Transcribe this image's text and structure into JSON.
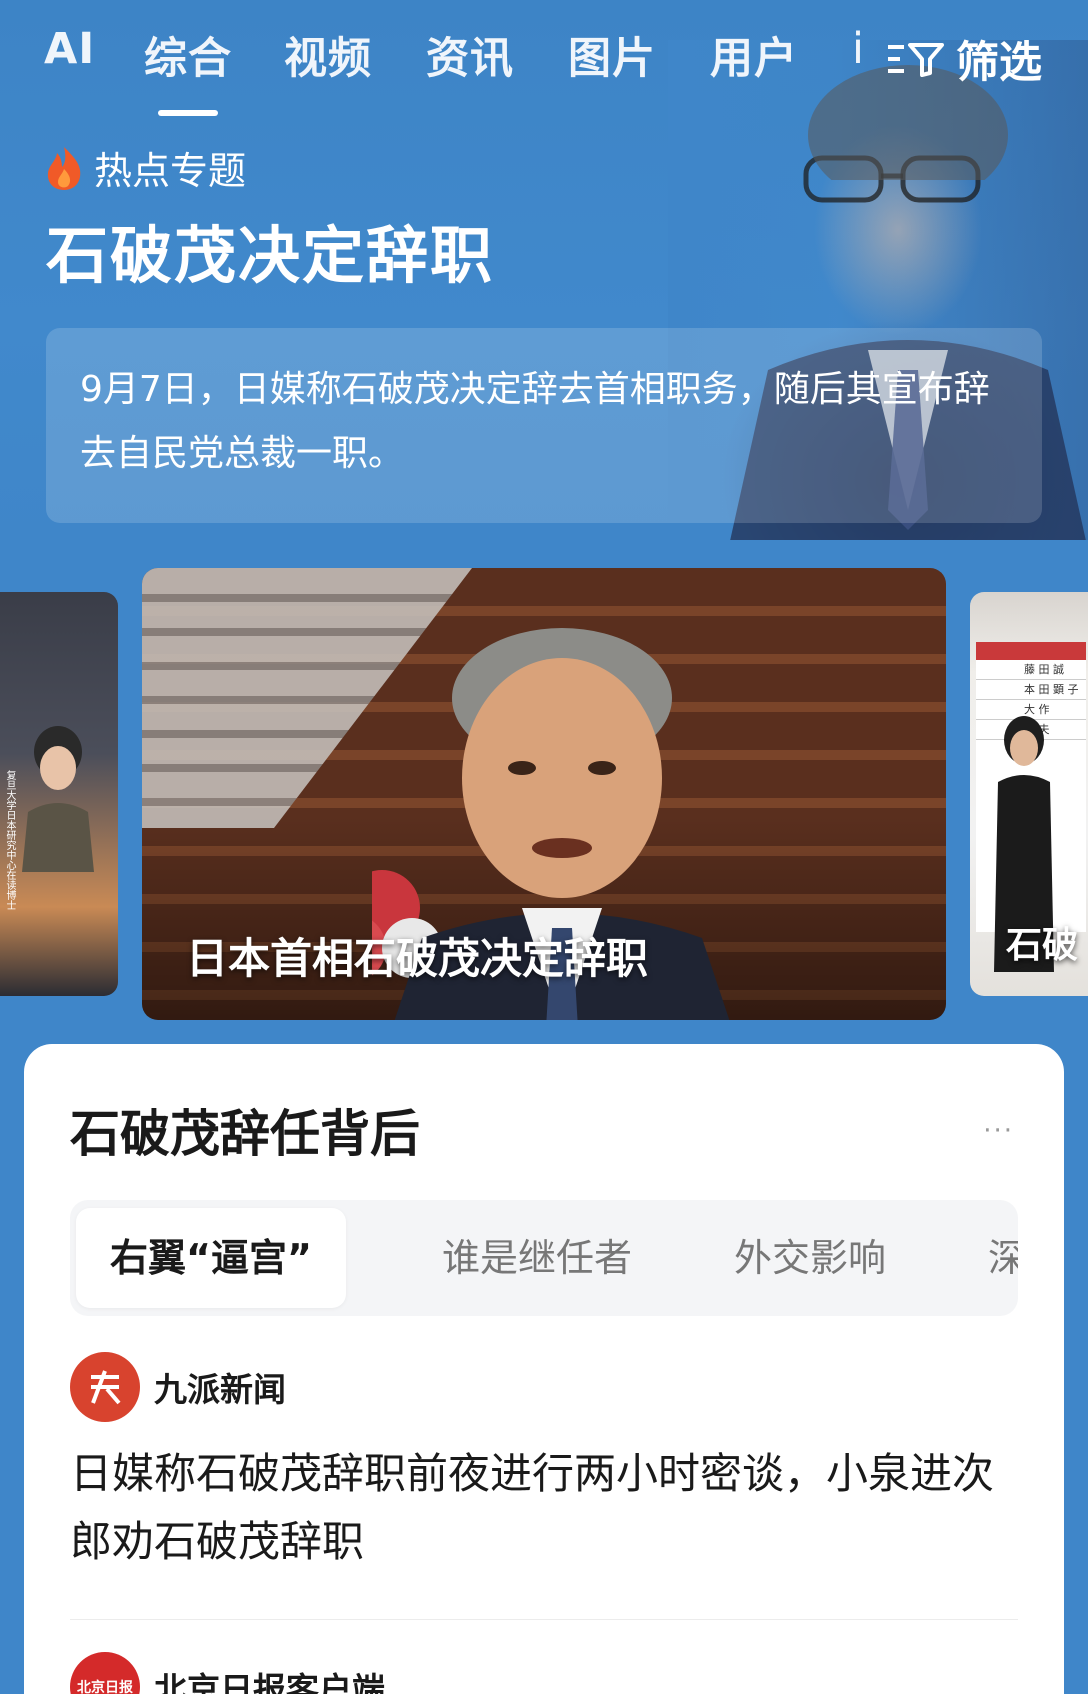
{
  "tabs": [
    {
      "label": "AI"
    },
    {
      "label": "综合",
      "active": true
    },
    {
      "label": "视频"
    },
    {
      "label": "资讯"
    },
    {
      "label": "图片"
    },
    {
      "label": "用户"
    },
    {
      "label": "i"
    }
  ],
  "filter": {
    "label": "筛选",
    "icon": "filter-icon"
  },
  "hero": {
    "topic_label": "热点专题",
    "topic_icon": "flame-icon",
    "title": "石破茂决定辞职",
    "summary": "9月7日，日媒称石破茂决定辞去首相职务，随后其宣布辞去自民党总裁一职。"
  },
  "carousel": {
    "left_card_vertical_text": "复旦大学日本研究中心在读博士",
    "main_caption": "日本首相石破茂决定辞职",
    "right_caption": "石破",
    "board_rows": [
      "藤 田 誠",
      "本 田 顕 子",
      "大 作",
      "雅 夫"
    ]
  },
  "panel": {
    "title": "石破茂辞任背后",
    "more_label": "···",
    "subtabs": [
      "右翼“逼宫”",
      "谁是继任者",
      "外交影响",
      "深度"
    ],
    "news": [
      {
        "source": "九派新闻",
        "logo_text": "ヽ",
        "logo_color": "#d8432e",
        "title": "日媒称石破茂辞职前夜进行两小时密谈，小泉进次郎劝石破茂辞职"
      },
      {
        "source": "北京日报客户端",
        "logo_text": "北京日报",
        "logo_color": "#d42a2a",
        "title": ""
      }
    ]
  },
  "colors": {
    "background": "#3f86c9",
    "panel": "#ffffff",
    "accent_red": "#d8432e"
  }
}
